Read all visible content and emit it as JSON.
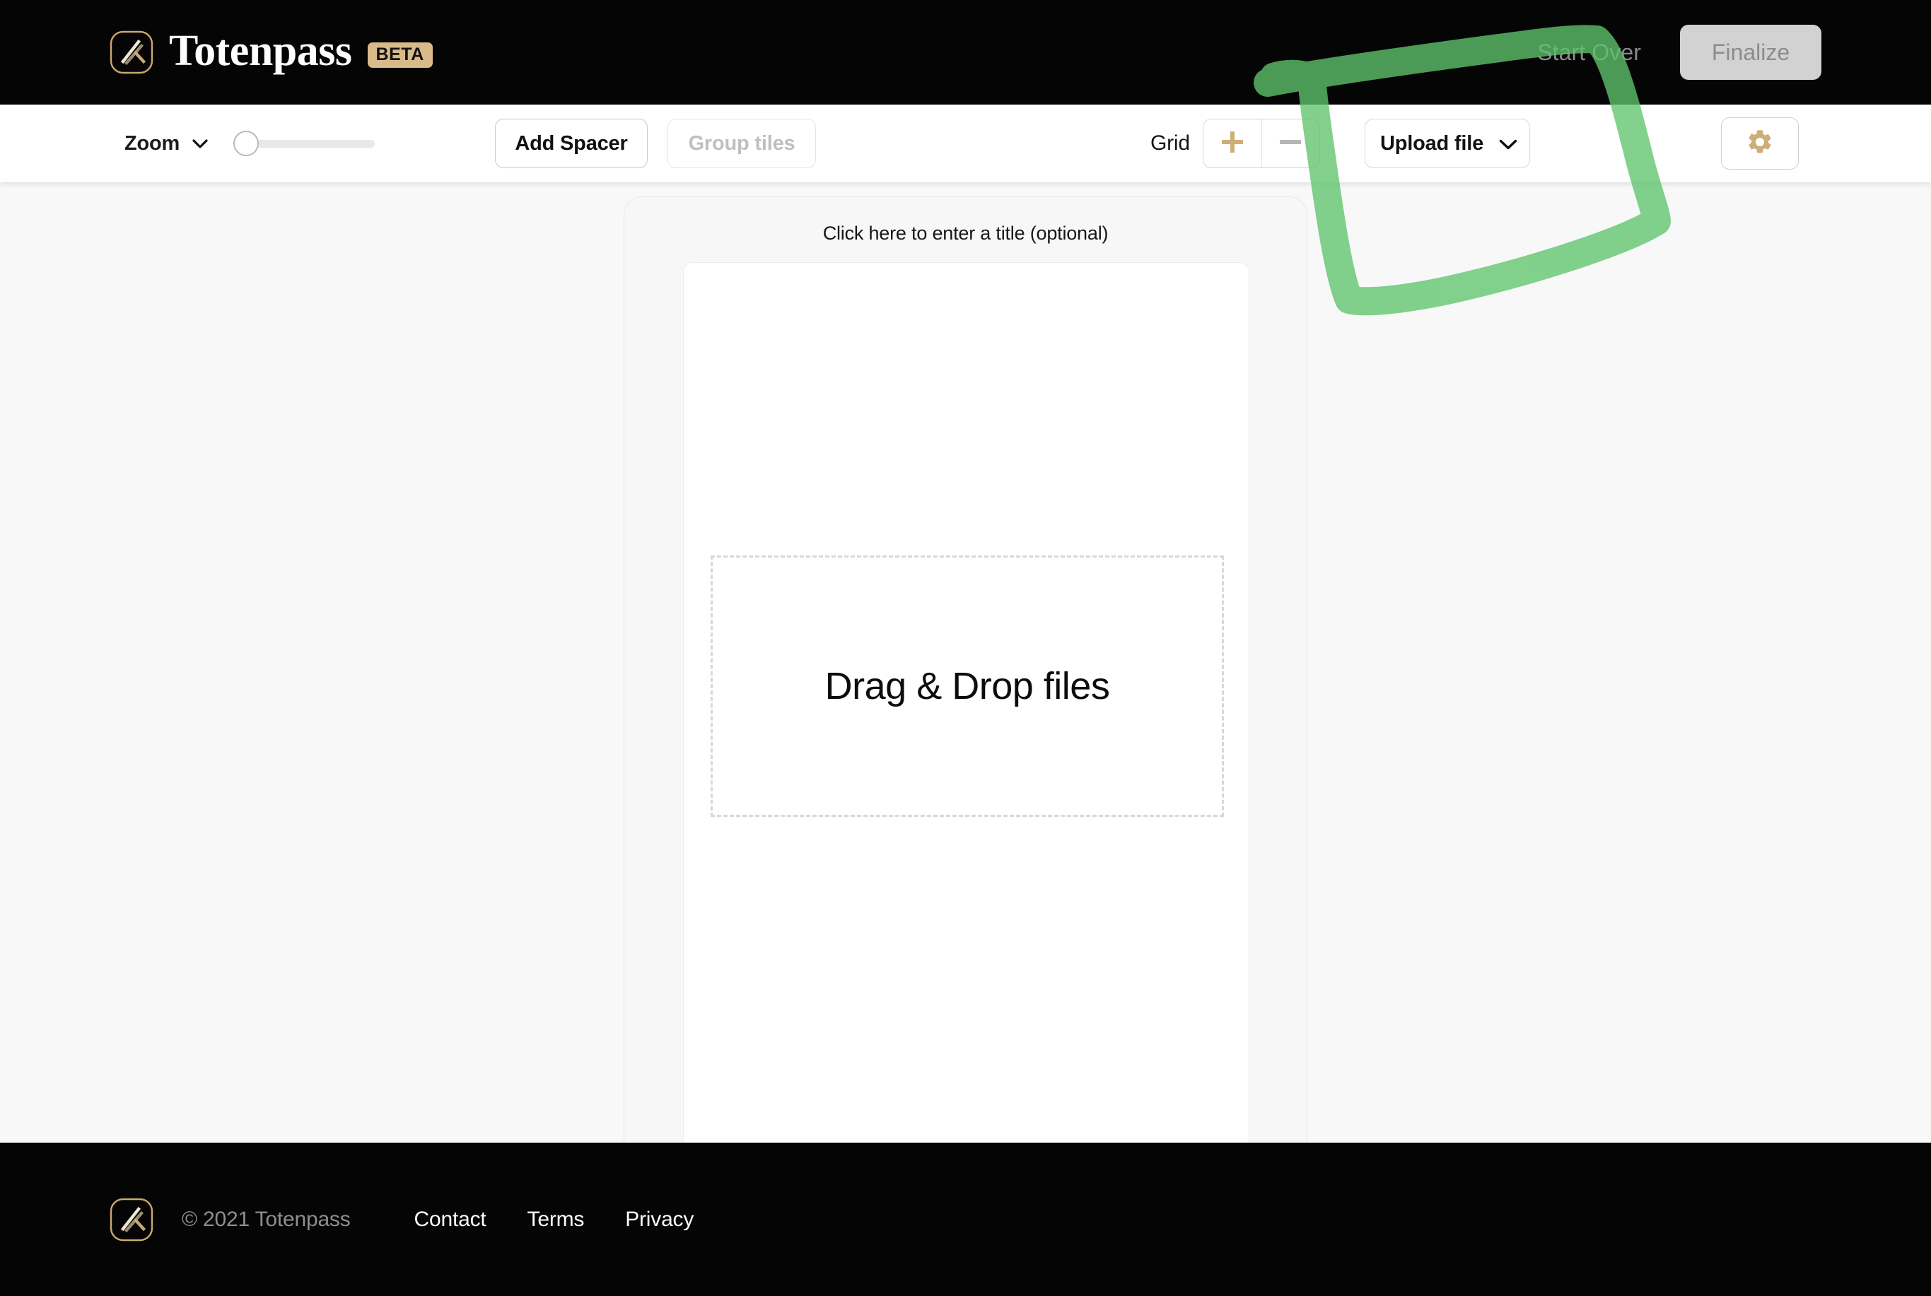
{
  "header": {
    "brand_name": "Totenpass",
    "beta_badge": "BETA",
    "logo_icon": "totenpass-logo-icon",
    "start_over_label": "Start Over",
    "finalize_label": "Finalize",
    "background_color": "#050505",
    "accent_color": "#cdae78"
  },
  "toolbar": {
    "zoom_label": "Zoom",
    "zoom_chevron_icon": "chevron-down-icon",
    "zoom_slider_value": "0",
    "add_spacer_label": "Add Spacer",
    "group_tiles_label": "Group tiles",
    "group_tiles_disabled": "true",
    "grid_label": "Grid",
    "grid_increase_icon": "plus-icon",
    "grid_decrease_icon": "minus-icon",
    "upload_label": "Upload file",
    "upload_chevron_icon": "chevron-down-icon",
    "settings_icon": "gear-icon"
  },
  "canvas": {
    "title_placeholder": "Click here to enter a title (optional)",
    "dropzone_label": "Drag & Drop files"
  },
  "annotation": {
    "type": "freehand-marker-rectangle",
    "color": "#6ecb79",
    "target": "Upload file"
  },
  "footer": {
    "logo_icon": "totenpass-logo-icon",
    "copyright": "© 2021 Totenpass",
    "links": [
      {
        "label": "Contact"
      },
      {
        "label": "Terms"
      },
      {
        "label": "Privacy"
      }
    ]
  }
}
